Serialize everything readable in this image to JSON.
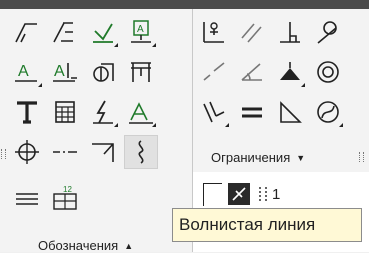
{
  "left_group": {
    "label": "Обозначения",
    "rows": [
      [
        "roughness-icon",
        "leader-icon",
        "base-mark-icon",
        "position-marker-icon"
      ],
      [
        "text-underline-icon",
        "text-sort-icon",
        "tolerance-icon",
        "table-icon"
      ],
      [
        "text-icon",
        "table-editor-icon",
        "lightning-icon",
        "text-style-icon"
      ],
      [
        "center-mark-icon",
        "axis-line-icon",
        "corner-mark-icon",
        "wavy-line-icon"
      ]
    ],
    "extra_row": [
      "wall-hatch-icon",
      "spec-table-icon"
    ]
  },
  "right_group": {
    "label": "Ограничения",
    "rows": [
      [
        "fix-point-icon",
        "parallel-icon",
        "perpendicular-icon",
        "tangent-icon"
      ],
      [
        "collinear-icon",
        "angle-icon",
        "horizontal-icon",
        "concentric-icon"
      ],
      [
        "coincident-icon",
        "equal-icon",
        "right-angle-icon",
        "symmetry-icon"
      ]
    ]
  },
  "bottom_toolbar": {
    "select_icon": "select-icon",
    "snap_icon": "snap-icon",
    "ortho_label": "1"
  },
  "tooltip": {
    "text": "Волнистая линия"
  }
}
